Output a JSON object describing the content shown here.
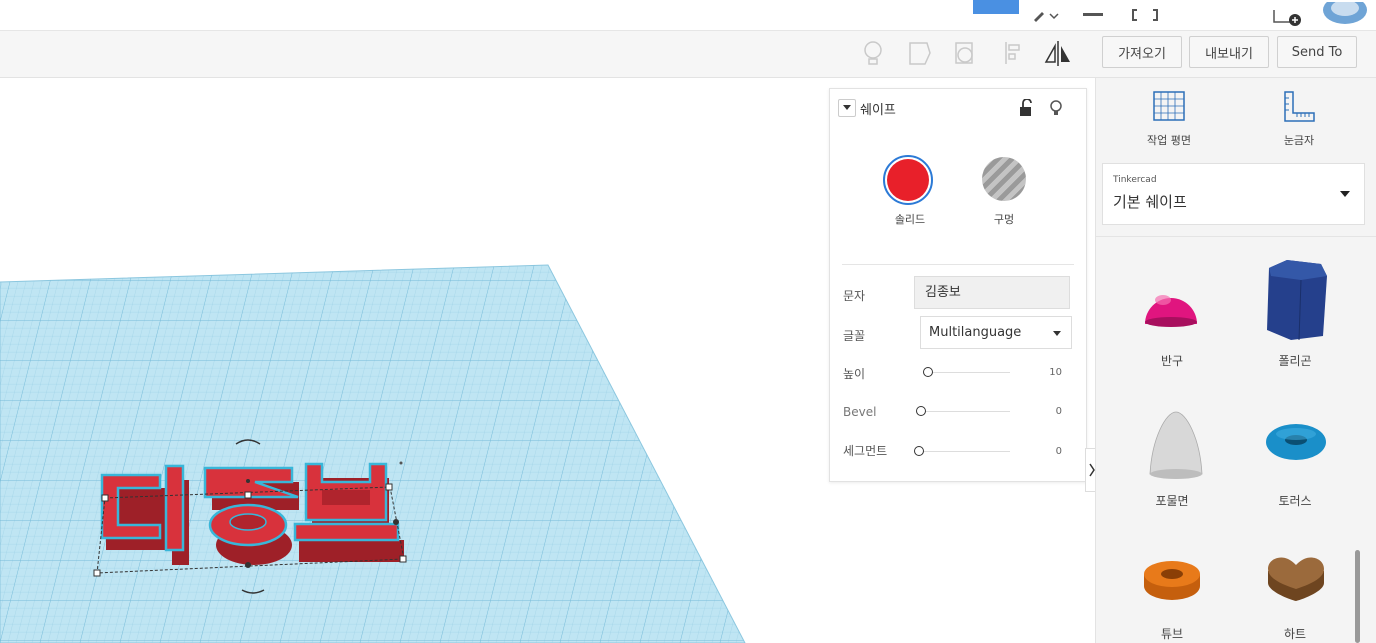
{
  "toolbar": {
    "import_label": "가져오기",
    "export_label": "내보내기",
    "sendto_label": "Send To"
  },
  "inspector": {
    "title": "쉐이프",
    "solid_label": "솔리드",
    "hole_label": "구멍",
    "text_label": "문자",
    "text_value": "김종보",
    "font_label": "글꼴",
    "font_value": "Multilanguage",
    "height_label": "높이",
    "height_value": "10",
    "bevel_label": "Bevel",
    "bevel_value": "0",
    "segments_label": "세그먼트",
    "segments_value": "0",
    "colors": {
      "solid": "#e8202a",
      "hole": "#a0a0a0"
    }
  },
  "right_panel": {
    "workplane_label": "작업 평면",
    "ruler_label": "눈금자",
    "library_small": "Tinkercad",
    "library_name": "기본 쉐이프",
    "shapes": [
      {
        "label": "반구",
        "icon": "hemisphere-icon",
        "color": "#e0157f"
      },
      {
        "label": "폴리곤",
        "icon": "polygon-icon",
        "color": "#25408c"
      },
      {
        "label": "포물면",
        "icon": "paraboloid-icon",
        "color": "#d8d8d8"
      },
      {
        "label": "토러스",
        "icon": "torus-icon",
        "color": "#1a8fc9"
      },
      {
        "label": "튜브",
        "icon": "tube-icon",
        "color": "#e87a1a"
      },
      {
        "label": "하트",
        "icon": "heart-icon",
        "color": "#8b5a2b"
      }
    ]
  },
  "scene": {
    "text_object": "김종보",
    "object_color": "#d8303a",
    "grid_color": "#a9d9ec"
  }
}
